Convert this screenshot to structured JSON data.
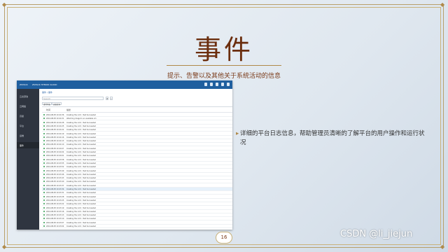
{
  "slide": {
    "title": "事件",
    "subtitle": "提示、告警以及其他关于系统活动的信息",
    "bullet": "详细的平台日志信息，帮助管理员清晰的了解平台的用户操作和运行状况",
    "page_number": "16",
    "watermark": "CSDN @li_jiejun"
  },
  "screenshot": {
    "brand": "ZSTACK",
    "app_title": "ZSTACK HYBRID CLOUD",
    "sidebar": [
      {
        "label": "云资源池"
      },
      {
        "label": "云网络"
      },
      {
        "label": "高级"
      },
      {
        "label": "平台"
      },
      {
        "label": "运维"
      },
      {
        "label": "事件",
        "active": true
      }
    ],
    "breadcrumb": "事件 / 事件",
    "search_placeholder": "Search",
    "filters": [
      "事件列表",
      "高级查询"
    ],
    "columns": [
      "时间",
      "描述"
    ],
    "rows": [
      {
        "ts": "2016-08-05 10:24:36",
        "msg": "Creating the vm3 - Test Succeeded"
      },
      {
        "ts": "2016-08-05 10:24:31",
        "msg": "Attaching image to an available vm"
      },
      {
        "ts": "2016-08-05 10:24:28",
        "msg": "Creating the vm3 - Test Succeeded"
      },
      {
        "ts": "2016-08-05 10:24:25",
        "msg": "Creating the vm3 - Test Succeeded"
      },
      {
        "ts": "2016-08-05 10:24:22",
        "msg": "Creating the vm3 - Test Succeeded"
      },
      {
        "ts": "2016-08-05 10:24:19",
        "msg": "Creating the vm3 - Test Succeeded"
      },
      {
        "ts": "2016-08-05 10:24:16",
        "msg": "Creating the vm3 - Test Succeeded"
      },
      {
        "ts": "2016-08-05 10:24:13",
        "msg": "Creating the vm3 - Test Succeeded"
      },
      {
        "ts": "2016-08-05 10:24:10",
        "msg": "Creating the vm3 - Test Succeeded"
      },
      {
        "ts": "2016-08-05 10:24:07",
        "msg": "Creating the vm3 - Test Succeeded"
      },
      {
        "ts": "2016-08-05 10:24:04",
        "msg": "Creating the vm3 - Test Succeeded"
      },
      {
        "ts": "2016-08-05 10:24:01",
        "msg": "Creating the vm3 - Test Succeeded"
      },
      {
        "ts": "2016-08-05 10:23:58",
        "msg": "Creating the vm3 - Test Succeeded"
      },
      {
        "ts": "2016-08-05 10:23:55",
        "msg": "Creating the vm3 - Test Succeeded"
      },
      {
        "ts": "2016-08-05 10:23:52",
        "msg": "Creating the vm3 - Test Succeeded"
      },
      {
        "ts": "2016-08-05 10:23:49",
        "msg": "Creating the vm3 - Test Succeeded"
      },
      {
        "ts": "2016-08-05 10:23:46",
        "msg": "Creating the vm3 - Test Succeeded"
      },
      {
        "ts": "2016-08-05 10:23:43",
        "msg": "Creating the vm3 - Test Succeeded"
      },
      {
        "ts": "2016-08-05 10:23:40",
        "msg": "Creating the vm3 - Test Succeeded"
      },
      {
        "ts": "2016-08-05 10:23:37",
        "msg": "Creating the vm3 - Test Succeeded"
      },
      {
        "ts": "2016-08-05 10:23:34",
        "msg": "Creating the vm3 - Test Succeeded",
        "hl": true
      },
      {
        "ts": "2016-08-05 10:23:31",
        "msg": "Creating the vm3 - Test Succeeded"
      },
      {
        "ts": "2016-08-05 10:23:28",
        "msg": "Creating the vm3 - Test Succeeded"
      },
      {
        "ts": "2016-08-05 10:23:25",
        "msg": "Creating the vm3 - Test Succeeded"
      },
      {
        "ts": "2016-08-05 10:23:22",
        "msg": "Creating the vm3 - Test Succeeded"
      },
      {
        "ts": "2016-08-05 10:23:19",
        "msg": "Creating the vm3 - Test Succeeded"
      },
      {
        "ts": "2016-08-05 10:23:16",
        "msg": "Creating the vm3 - Test Succeeded"
      },
      {
        "ts": "2016-08-05 10:23:13",
        "msg": "Creating the vm3 - Test Succeeded"
      },
      {
        "ts": "2016-08-05 10:23:10",
        "msg": "Creating the vm3 - Test Succeeded"
      },
      {
        "ts": "2016-08-05 10:23:07",
        "msg": "Creating the vm3 - Test Succeeded"
      },
      {
        "ts": "2016-08-05 10:23:04",
        "msg": "Creating the vm3 - Test Succeeded"
      }
    ]
  }
}
